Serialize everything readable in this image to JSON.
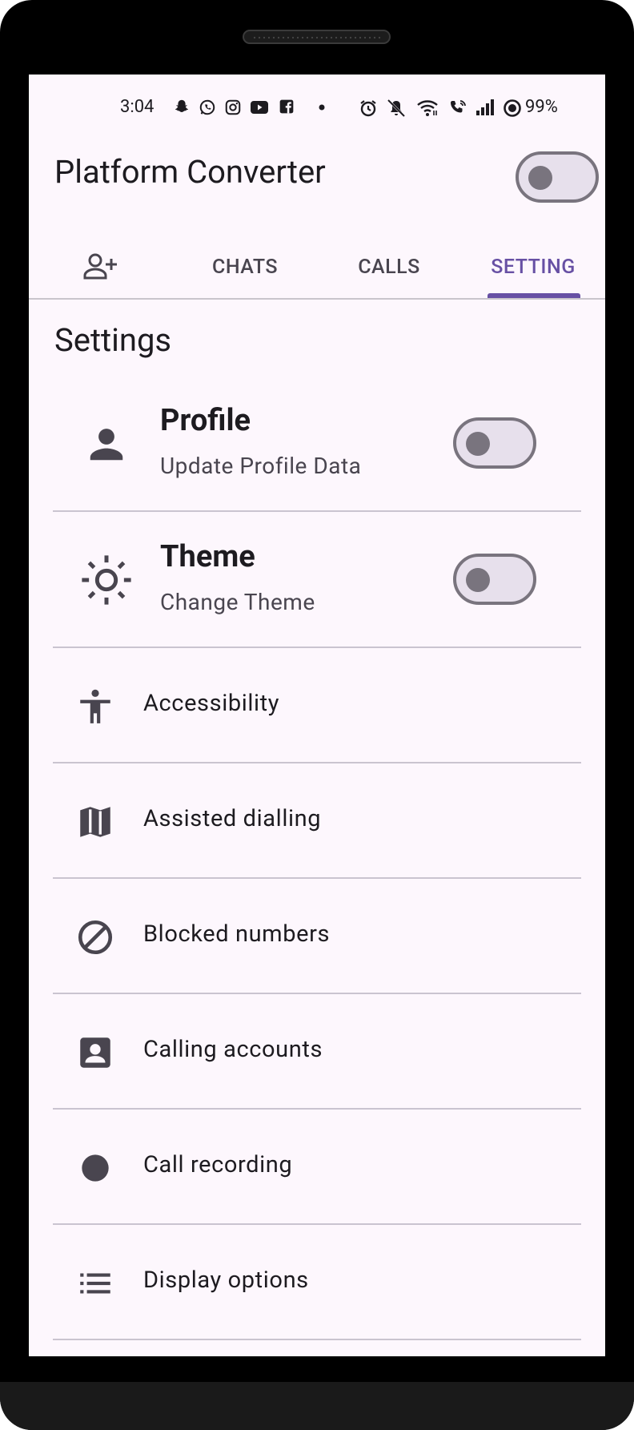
{
  "status": {
    "time": "3:04",
    "battery": "99%"
  },
  "appbar": {
    "title": "Platform Converter"
  },
  "tabs": [
    {
      "label": "",
      "icon": "add-person-icon"
    },
    {
      "label": "CHATS"
    },
    {
      "label": "CALLS"
    },
    {
      "label": "SETTING"
    }
  ],
  "settings": {
    "section_title": "Settings",
    "profile": {
      "title": "Profile",
      "subtitle": "Update Profile Data"
    },
    "theme": {
      "title": "Theme",
      "subtitle": "Change Theme"
    },
    "items": [
      {
        "label": "Accessibility",
        "icon": "accessibility-icon"
      },
      {
        "label": "Assisted dialling",
        "icon": "map-icon"
      },
      {
        "label": "Blocked numbers",
        "icon": "block-icon"
      },
      {
        "label": "Calling accounts",
        "icon": "account-box-icon"
      },
      {
        "label": "Call recording",
        "icon": "record-icon"
      },
      {
        "label": "Display options",
        "icon": "list-icon"
      }
    ]
  },
  "colors": {
    "accent": "#6750A4",
    "background": "#FDF7FD",
    "icon": "#49454F"
  }
}
